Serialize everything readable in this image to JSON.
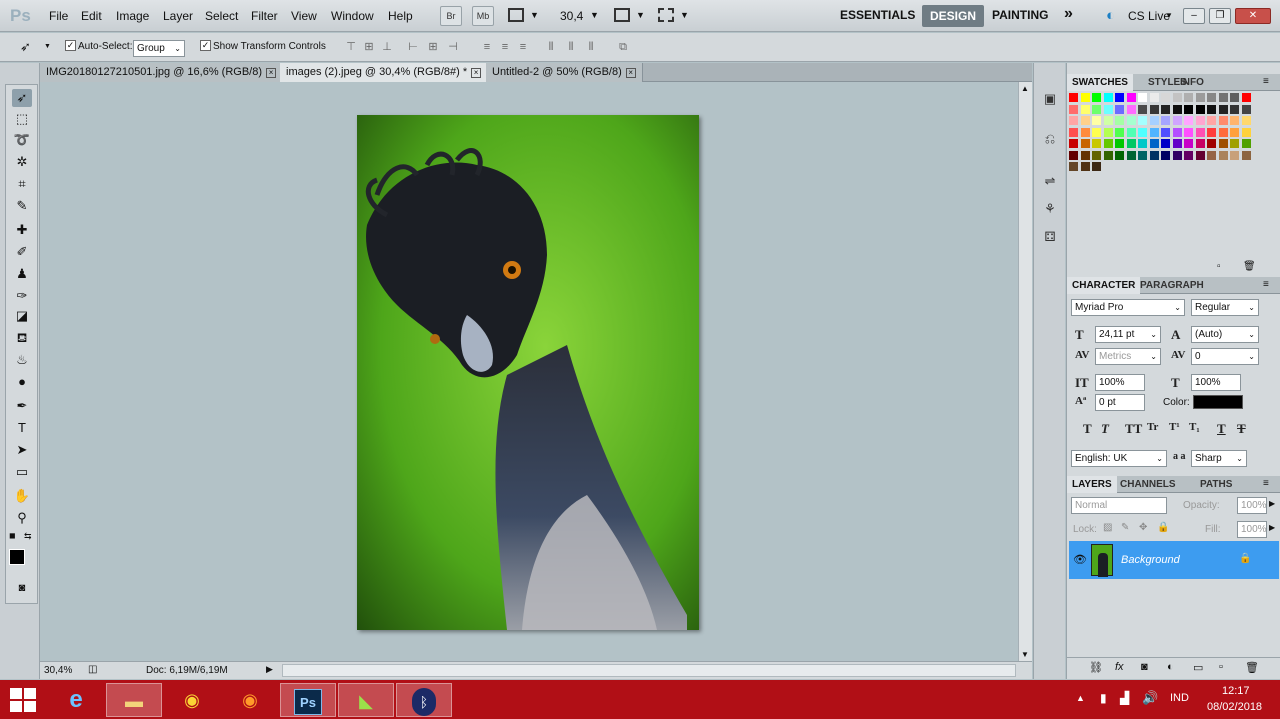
{
  "app": {
    "logo": "Ps"
  },
  "menu": [
    "File",
    "Edit",
    "Image",
    "Layer",
    "Select",
    "Filter",
    "View",
    "Window",
    "Help"
  ],
  "toolbar": {
    "br": "Br",
    "mb": "Mb",
    "zoom": "30,4"
  },
  "workspaces": {
    "essentials": "ESSENTIALS",
    "design": "DESIGN",
    "painting": "PAINTING",
    "more": "»",
    "cslive": "CS Live"
  },
  "options": {
    "auto_select_label": "Auto-Select:",
    "auto_select_value": "Group",
    "transform_label": "Show Transform Controls"
  },
  "tabs": [
    {
      "title": "IMG20180127210501.jpg @ 16,6% (RGB/8)"
    },
    {
      "title": "images (2).jpeg @ 30,4% (RGB/8#) *"
    },
    {
      "title": "Untitled-2 @ 50% (RGB/8)"
    }
  ],
  "status": {
    "zoom": "30,4%",
    "doc": "Doc: 6,19M/6,19M"
  },
  "swatches_panel": {
    "tabs": [
      "SWATCHES",
      "STYLES",
      "INFO"
    ]
  },
  "character_panel": {
    "tabs": [
      "CHARACTER",
      "PARAGRAPH"
    ],
    "font_family": "Myriad Pro",
    "font_style": "Regular",
    "font_size": "24,11 pt",
    "leading": "(Auto)",
    "kerning": "Metrics",
    "tracking": "0",
    "vscale": "100%",
    "hscale": "100%",
    "baseline": "0 pt",
    "color_label": "Color:",
    "styles": [
      "T",
      "T",
      "TT",
      "Tr",
      "T¹",
      "T₁",
      "T",
      "T"
    ],
    "language": "English: UK",
    "antialias": "Sharp",
    "aa_label": "a a"
  },
  "layers_panel": {
    "tabs": [
      "LAYERS",
      "CHANNELS",
      "PATHS"
    ],
    "blend": "Normal",
    "opacity_label": "Opacity:",
    "opacity": "100%",
    "lock_label": "Lock:",
    "fill_label": "Fill:",
    "fill": "100%",
    "layer_name": "Background"
  },
  "taskbar": {
    "time": "12:17",
    "date": "08/02/2018",
    "lang": "IND",
    "ps_label": "Ps"
  },
  "colors": {
    "accent": "#6f7c84",
    "layer_selected": "#3d9cf0",
    "taskbar": "#b10f16"
  }
}
